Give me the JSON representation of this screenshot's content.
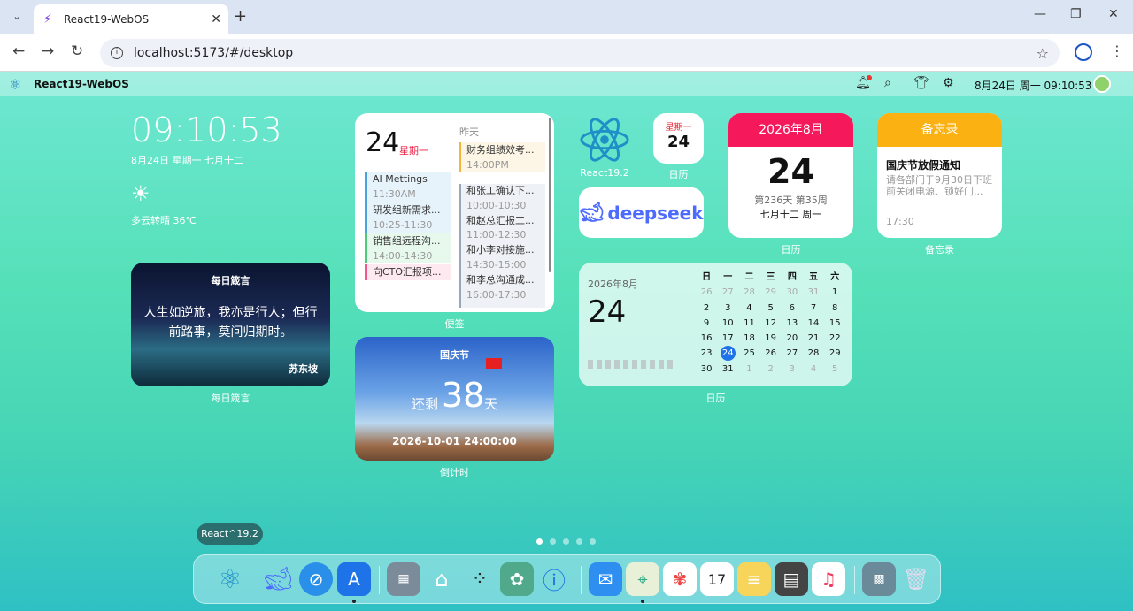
{
  "browser": {
    "tab_title": "React19-WebOS",
    "url": "localhost:5173/#/desktop"
  },
  "menubar": {
    "app_name": "React19-WebOS",
    "datetime": "8月24日 周一 09:10:53"
  },
  "clock_widget": {
    "time": "09:10:53",
    "date": "8月24日 星期一 七月十二",
    "weather": "多云转晴 36℃"
  },
  "quote_widget": {
    "title": "每日箴言",
    "text": "人生如逆旅，我亦是行人；但行前路事，莫问归期时。",
    "author": "苏东坡",
    "label": "每日箴言"
  },
  "notes_widget": {
    "day": "24",
    "weekday": "星期一",
    "yesterday": "昨天",
    "today_events": [
      {
        "title": "AI Mettings",
        "time": "11:30AM",
        "color": "#4aa3df"
      },
      {
        "title": "研发组新需求...",
        "time": "10:25-11:30",
        "color": "#4aa3df"
      },
      {
        "title": "销售组远程沟...",
        "time": "14:00-14:30",
        "color": "#4ccb7a"
      },
      {
        "title": "向CTO汇报项...",
        "time": "",
        "color": "#f0578a"
      }
    ],
    "yesterday_events": [
      {
        "title": "财务组绩效考...",
        "time": "14:00PM",
        "color": "#f3b63d"
      },
      {
        "title": "和张工确认下...",
        "time": "10:00-10:30",
        "color": "#9aa7b8"
      },
      {
        "title": "和赵总汇报工...",
        "time": "11:00-12:30",
        "color": "#9aa7b8"
      },
      {
        "title": "和小李对接施...",
        "time": "14:30-15:00",
        "color": "#9aa7b8"
      },
      {
        "title": "和李总沟通成...",
        "time": "16:00-17:30",
        "color": "#9aa7b8"
      }
    ],
    "label": "便签"
  },
  "countdown_widget": {
    "title": "国庆节",
    "remain": "还剩",
    "days": "38",
    "unit": "天",
    "target": "2026-10-01 24:00:00",
    "label": "倒计时"
  },
  "apps": {
    "react": {
      "label": "React19.2"
    },
    "calendar_icon": {
      "month": "星期一",
      "day": "24",
      "label": "日历"
    },
    "deepseek": {
      "text": "deepseek"
    }
  },
  "calendar_card": {
    "header": "2026年8月",
    "day": "24",
    "info": "第236天 第35周",
    "lunar": "七月十二 周一",
    "label": "日历"
  },
  "memo": {
    "header": "备忘录",
    "title": "国庆节放假通知",
    "body": "请各部门于9月30日下班前关闭电源、锁好门...",
    "time": "17:30",
    "label": "备忘录"
  },
  "month_calendar": {
    "year_month": "2026年8月",
    "day": "24",
    "weekdays": [
      "日",
      "一",
      "二",
      "三",
      "四",
      "五",
      "六"
    ],
    "weeks": [
      [
        "26",
        "27",
        "28",
        "29",
        "30",
        "31",
        "1"
      ],
      [
        "2",
        "3",
        "4",
        "5",
        "6",
        "7",
        "8"
      ],
      [
        "9",
        "10",
        "11",
        "12",
        "13",
        "14",
        "15"
      ],
      [
        "16",
        "17",
        "18",
        "19",
        "20",
        "21",
        "22"
      ],
      [
        "23",
        "24",
        "25",
        "26",
        "27",
        "28",
        "29"
      ],
      [
        "30",
        "31",
        "1",
        "2",
        "3",
        "4",
        "5"
      ]
    ],
    "label": "日历"
  },
  "dock": {
    "tooltip": "React^19.2"
  }
}
